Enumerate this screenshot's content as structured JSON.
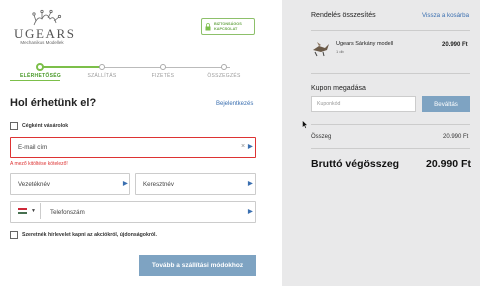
{
  "brand": {
    "name": "UGEARS",
    "tagline": "Mechanikus Modellek"
  },
  "secure_badge": {
    "line1": "BIZTONSÁGOS",
    "line2": "KAPCSOLAT"
  },
  "steps": [
    {
      "label": "ELÉRHETŐSÉG",
      "active": true
    },
    {
      "label": "SZÁLLÍTÁS",
      "active": false
    },
    {
      "label": "FIZETÉS",
      "active": false
    },
    {
      "label": "ÖSSZEGZÉS",
      "active": false
    }
  ],
  "contact": {
    "heading": "Hol érhetünk el?",
    "login_link": "Bejelentkezés",
    "company_checkbox": "Cégként vásárolok",
    "email_placeholder": "E-mail cím",
    "email_error": "A mező kitöltése kötelező!",
    "lastname_placeholder": "Vezetéknév",
    "firstname_placeholder": "Keresztnév",
    "phone_placeholder": "Telefonszám",
    "newsletter_checkbox": "Szeretnék hírlevelet kapni az akciókról, újdonságokról.",
    "submit_label": "Tovább a szállítási módokhoz"
  },
  "summary": {
    "title": "Rendelés összesítés",
    "back_link": "Vissza a kosárba",
    "product": {
      "name": "Ugears Sárkány modell",
      "qty": "1 db",
      "price": "20.990 Ft"
    },
    "coupon_title": "Kupon megadása",
    "coupon_placeholder": "Kuponkód",
    "coupon_button": "Beváltás",
    "subtotal_label": "Összeg",
    "subtotal_value": "20.990 Ft",
    "total_label": "Bruttó végösszeg",
    "total_value": "20.990 Ft"
  },
  "colors": {
    "accent": "#7cbf4a",
    "button": "#7ea3c2",
    "error": "#dd3333",
    "link": "#3a6fb0",
    "panel": "#e9e9ea"
  },
  "icons": {
    "brand": "gear-logo-icon",
    "secure": "lock-icon",
    "flag": "hungary-flag-icon",
    "clear": "close-icon",
    "autofill": "password-manager-icon"
  }
}
